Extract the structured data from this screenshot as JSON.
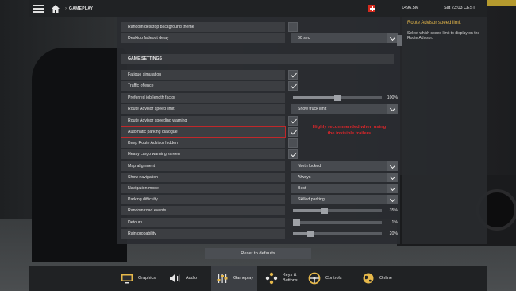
{
  "topbar": {
    "breadcrumb": "GAMEPLAY",
    "money": "€496.5M",
    "time": "Sat 23:03 CEST"
  },
  "rows": [
    {
      "label": "Random desktop background theme",
      "kind": "checkbox",
      "checked": false
    },
    {
      "label": "Desktop fadeout delay",
      "kind": "select",
      "value": "60 sec"
    },
    {
      "section": "GAME SETTINGS"
    },
    {
      "label": "Fatigue simulation",
      "kind": "checkbox",
      "checked": true
    },
    {
      "label": "Traffic offence",
      "kind": "checkbox",
      "checked": true
    },
    {
      "label": "Preferred job length factor",
      "kind": "slider",
      "value": "100%",
      "fraction": 0.5
    },
    {
      "label": "Route Advisor speed limit",
      "kind": "select",
      "value": "Show truck limit"
    },
    {
      "label": "Route Advisor speeding warning",
      "kind": "checkbox",
      "checked": true
    },
    {
      "label": "Automatic parking dialogue",
      "kind": "checkbox",
      "checked": true,
      "highlight": true
    },
    {
      "label": "Keep Route Advisor hidden",
      "kind": "checkbox",
      "checked": false
    },
    {
      "label": "Heavy cargo warning screen",
      "kind": "checkbox",
      "checked": true
    },
    {
      "label": "Map alignment",
      "kind": "select",
      "value": "North locked"
    },
    {
      "label": "Show navigation",
      "kind": "select",
      "value": "Always"
    },
    {
      "label": "Navigation mode",
      "kind": "select",
      "value": "Best"
    },
    {
      "label": "Parking difficulty",
      "kind": "select",
      "value": "Skilled parking"
    },
    {
      "label": "Random road events",
      "kind": "slider",
      "value": "35%",
      "fraction": 0.35
    },
    {
      "label": "Detours",
      "kind": "slider",
      "value": "1%",
      "fraction": 0.01
    },
    {
      "label": "Rain probability",
      "kind": "slider",
      "value": "20%",
      "fraction": 0.2
    }
  ],
  "note": {
    "line1": "Highly recommended when using",
    "line2": "the invisible trailers"
  },
  "info": {
    "title": "Route Advisor speed limit",
    "description": "Select which speed limit to display on the Route Advisor."
  },
  "reset_label": "Reset to defaults",
  "tabs": [
    {
      "label": "Graphics",
      "icon": "monitor-icon",
      "active": false
    },
    {
      "label": "Audio",
      "icon": "speaker-icon",
      "active": false
    },
    {
      "label": "Gameplay",
      "icon": "sliders-icon",
      "active": true
    },
    {
      "label": "Keys & Buttons",
      "icon": "gamepad-buttons-icon",
      "active": false
    },
    {
      "label": "Controls",
      "icon": "steering-wheel-icon",
      "active": false
    },
    {
      "label": "Online",
      "icon": "globe-icon",
      "active": false
    }
  ],
  "colors": {
    "accent_title": "#e6b84a",
    "highlight": "#d8262a"
  }
}
